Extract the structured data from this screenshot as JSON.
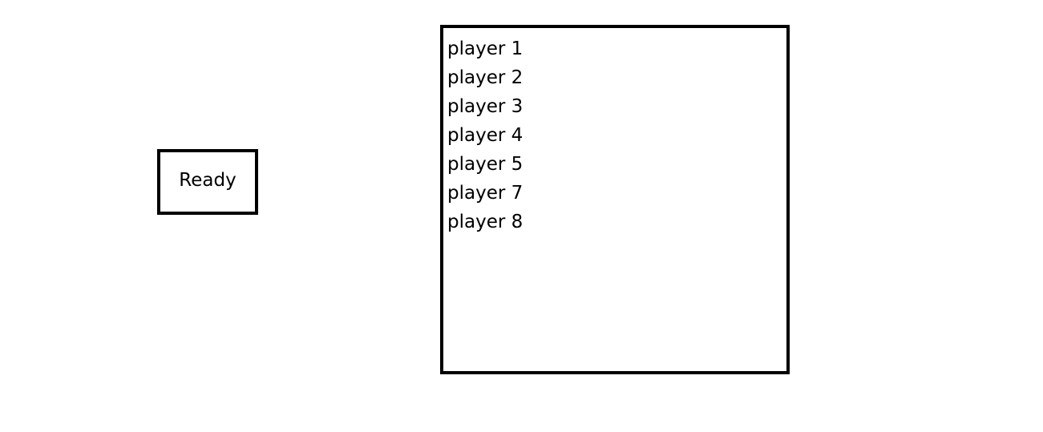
{
  "ready_button": {
    "label": "Ready"
  },
  "player_list": {
    "players": [
      "player 1",
      "player 2",
      "player 3",
      "player 4",
      "player 5",
      "player 7",
      "player 8"
    ]
  }
}
